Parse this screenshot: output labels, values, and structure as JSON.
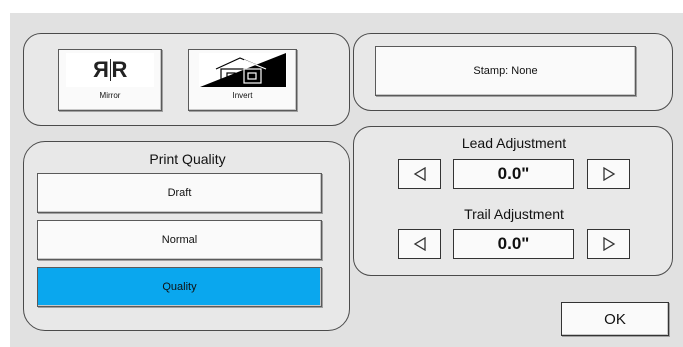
{
  "tools": {
    "mirror_label": "Mirror",
    "mirror_glyph_reversed": "R",
    "mirror_glyph": "R",
    "invert_label": "Invert"
  },
  "stamp": {
    "label": "Stamp: None"
  },
  "print_quality": {
    "title": "Print Quality",
    "options": [
      "Draft",
      "Normal",
      "Quality"
    ],
    "selected": "Quality"
  },
  "lead": {
    "title": "Lead Adjustment",
    "value": "0.0\""
  },
  "trail": {
    "title": "Trail Adjustment",
    "value": "0.0\""
  },
  "ok_label": "OK",
  "colors": {
    "selected": "#0aa7ee",
    "background": "#e1e1e1"
  }
}
